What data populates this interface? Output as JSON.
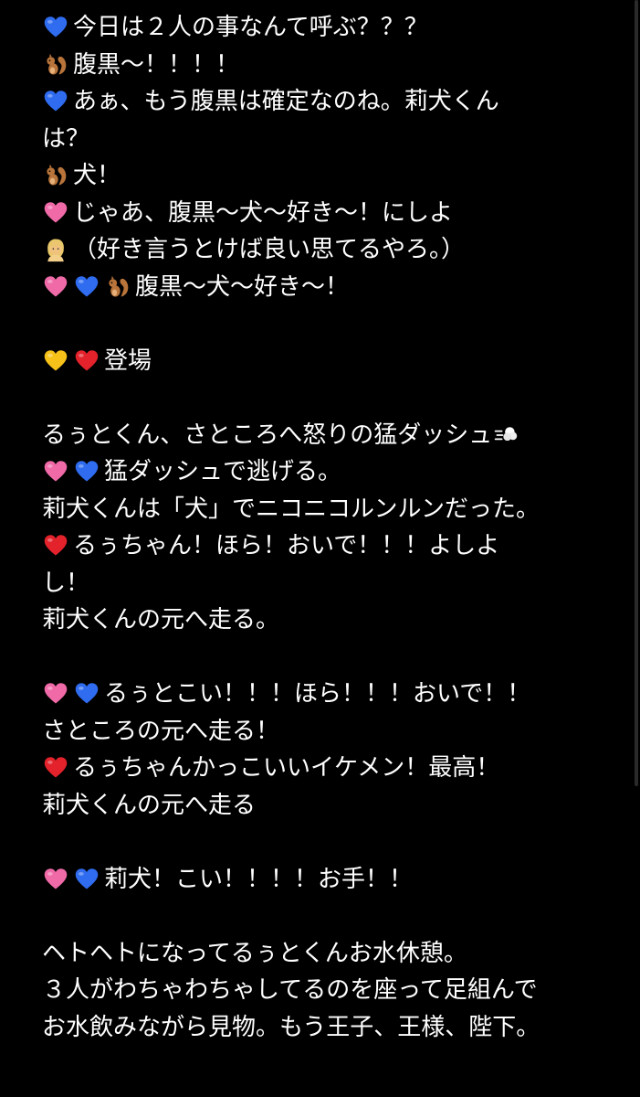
{
  "colors": {
    "background": "#000000",
    "text": "#ffffff",
    "blue-heart": "#2f6cf0",
    "pink-heart": "#f06aa8",
    "yellow-heart": "#f6c21a",
    "red-heart": "#e3222b",
    "squirrel": "#b8743a",
    "person": "#f1c27d"
  },
  "lines": [
    {
      "icons": [
        "blue-heart-icon"
      ],
      "text": "今日は２人の事なんて呼ぶ？？？"
    },
    {
      "icons": [
        "squirrel-icon"
      ],
      "text": "腹黒〜！！！！"
    },
    {
      "icons": [
        "blue-heart-icon"
      ],
      "text": "あぁ、もう腹黒は確定なのね。莉犬くん"
    },
    {
      "icons": [],
      "text": "は？"
    },
    {
      "icons": [
        "squirrel-icon"
      ],
      "text": "犬！"
    },
    {
      "icons": [
        "pink-heart-icon"
      ],
      "text": "じゃあ、腹黒〜犬〜好き〜！にしよ"
    },
    {
      "icons": [
        "person-icon"
      ],
      "text": "（好き言うとけば良い思てるやろ。）"
    },
    {
      "icons": [
        "pink-heart-icon",
        "blue-heart-icon",
        "squirrel-icon"
      ],
      "text": " 腹黒〜犬〜好き〜！"
    },
    {
      "icons": [],
      "text": ""
    },
    {
      "icons": [
        "yellow-heart-icon",
        "red-heart-icon"
      ],
      "text": "登場"
    },
    {
      "icons": [],
      "text": ""
    },
    {
      "icons": [],
      "text": "るぅとくん、さところへ怒りの猛ダッシュ",
      "trailing_icon": "dash-icon"
    },
    {
      "icons": [
        "pink-heart-icon",
        "blue-heart-icon"
      ],
      "text": "猛ダッシュで逃げる。"
    },
    {
      "icons": [],
      "text": "莉犬くんは「犬」でニコニコルンルンだった。"
    },
    {
      "icons": [
        "red-heart-icon"
      ],
      "text": "るぅちゃん！ほら！おいで！！！よしよ"
    },
    {
      "icons": [],
      "text": "し！"
    },
    {
      "icons": [],
      "text": "莉犬くんの元へ走る。"
    },
    {
      "icons": [],
      "text": ""
    },
    {
      "icons": [
        "pink-heart-icon",
        "blue-heart-icon"
      ],
      "text": "るぅとこい！！！ほら！！！おいで！！"
    },
    {
      "icons": [],
      "text": "さところの元へ走る！"
    },
    {
      "icons": [
        "red-heart-icon"
      ],
      "text": "るぅちゃんかっこいいイケメン！最高！"
    },
    {
      "icons": [],
      "text": "莉犬くんの元へ走る"
    },
    {
      "icons": [],
      "text": ""
    },
    {
      "icons": [
        "pink-heart-icon",
        "blue-heart-icon"
      ],
      "text": "莉犬！こい！！！！お手！！"
    },
    {
      "icons": [],
      "text": ""
    },
    {
      "icons": [],
      "text": "ヘトヘトになってるぅとくんお水休憩。"
    },
    {
      "icons": [],
      "text": "３人がわちゃわちゃしてるのを座って足組んで"
    },
    {
      "icons": [],
      "text": "お水飲みながら見物。もう王子、王様、陛下。"
    }
  ]
}
